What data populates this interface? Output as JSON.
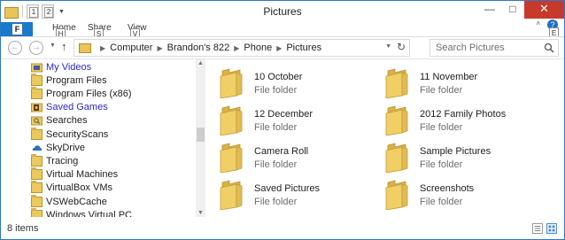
{
  "window": {
    "title": "Pictures",
    "quick_access_keys": [
      "1",
      "2"
    ],
    "caption": {
      "minimize": "—",
      "maximize": "□",
      "close": "✕"
    }
  },
  "ribbon": {
    "file_key": "F",
    "tabs": [
      {
        "label": "Home",
        "key": "H"
      },
      {
        "label": "Share",
        "key": "S"
      },
      {
        "label": "View",
        "key": "V"
      }
    ],
    "help_key": "E"
  },
  "address_bar": {
    "crumbs": [
      "Computer",
      "Brandon's 822",
      "Phone",
      "Pictures"
    ]
  },
  "search": {
    "placeholder": "Search Pictures",
    "value": ""
  },
  "nav_pane": {
    "items": [
      {
        "label": "My Videos",
        "icon": "video-folder-icon",
        "link": true
      },
      {
        "label": "Program Files",
        "icon": "folder-icon",
        "link": false
      },
      {
        "label": "Program Files (x86)",
        "icon": "folder-icon",
        "link": false
      },
      {
        "label": "Saved Games",
        "icon": "saved-games-icon",
        "link": true
      },
      {
        "label": "Searches",
        "icon": "searches-icon",
        "link": false
      },
      {
        "label": "SecurityScans",
        "icon": "folder-icon",
        "link": false
      },
      {
        "label": "SkyDrive",
        "icon": "skydrive-icon",
        "link": false
      },
      {
        "label": "Tracing",
        "icon": "folder-icon",
        "link": false
      },
      {
        "label": "Virtual Machines",
        "icon": "folder-icon",
        "link": false
      },
      {
        "label": "VirtualBox VMs",
        "icon": "folder-icon",
        "link": false
      },
      {
        "label": "VSWebCache",
        "icon": "folder-icon",
        "link": false
      },
      {
        "label": "Windows Virtual PC",
        "icon": "folder-icon",
        "link": false
      }
    ]
  },
  "content": {
    "items": [
      {
        "name": "10 October",
        "type": "File folder"
      },
      {
        "name": "11 November",
        "type": "File folder"
      },
      {
        "name": "12 December",
        "type": "File folder"
      },
      {
        "name": "2012 Family Photos",
        "type": "File folder"
      },
      {
        "name": "Camera Roll",
        "type": "File folder"
      },
      {
        "name": "Sample Pictures",
        "type": "File folder"
      },
      {
        "name": "Saved Pictures",
        "type": "File folder"
      },
      {
        "name": "Screenshots",
        "type": "File folder"
      }
    ]
  },
  "status": {
    "item_count": "8 items"
  },
  "colors": {
    "accent": "#1979ca",
    "close": "#c7392b",
    "link": "#2a2acb",
    "folder": "#ecc95e"
  }
}
